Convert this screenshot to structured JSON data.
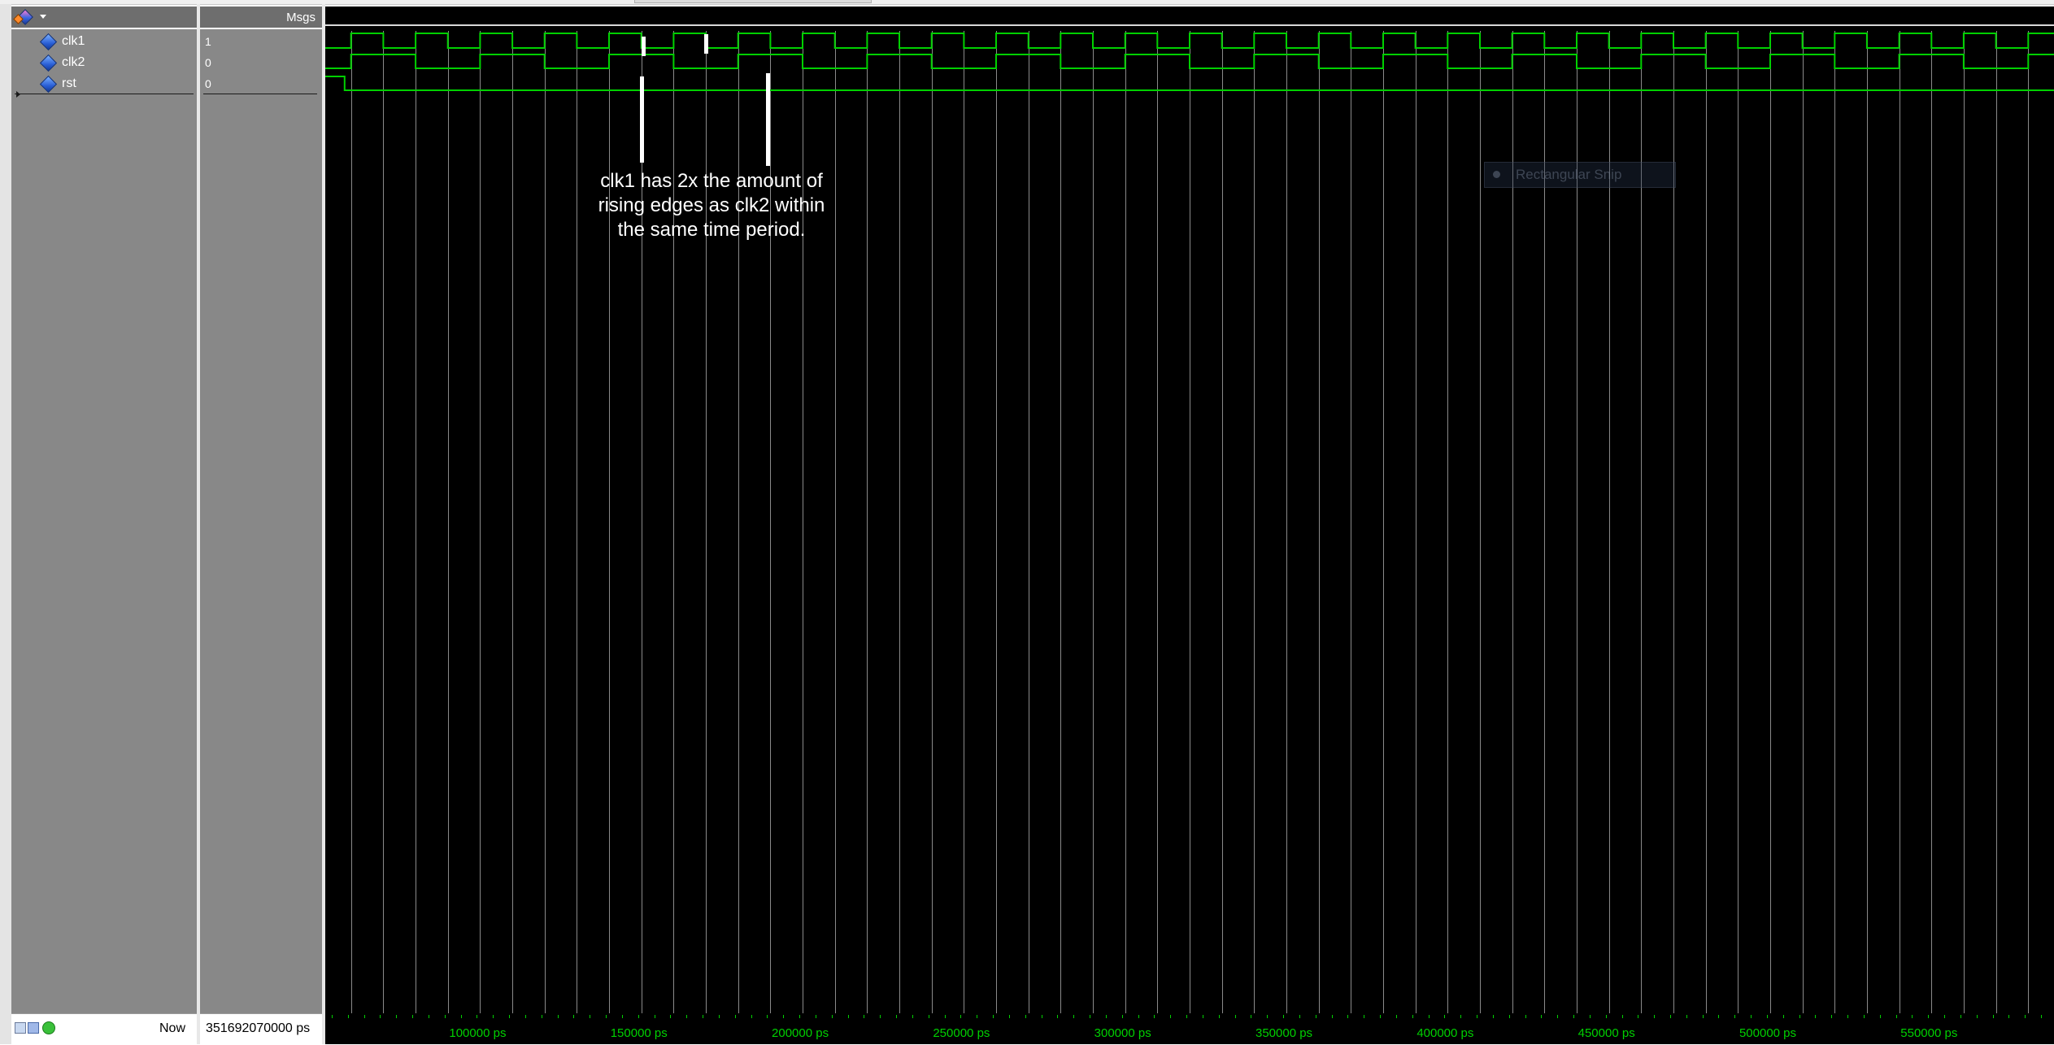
{
  "header": {
    "msgs_label": "Msgs",
    "toolbar_icon": "wave-select-icon"
  },
  "signals": [
    {
      "name": "clk1",
      "value": "1"
    },
    {
      "name": "clk2",
      "value": "0"
    },
    {
      "name": "rst",
      "value": "0"
    }
  ],
  "waves": {
    "clk1_period_ps": 20000,
    "clk2_period_ps": 40000,
    "rst_release_ps": 58000,
    "view_start_ps": 52000,
    "view_end_ps": 588000,
    "color": "#00d000",
    "grid_color": "#8a8a8a"
  },
  "annotation": {
    "line1": "clk1 has 2x the amount of",
    "line2": "rising edges as clk2 within",
    "line3": "the same time period."
  },
  "ghost_tooltip": "Rectangular Snip",
  "footer": {
    "now_label": "Now",
    "now_value": "351692070000 ps",
    "axis_labels": [
      "100000 ps",
      "150000 ps",
      "200000 ps",
      "250000 ps",
      "300000 ps",
      "350000 ps",
      "400000 ps",
      "450000 ps",
      "500000 ps",
      "550000 ps"
    ]
  }
}
